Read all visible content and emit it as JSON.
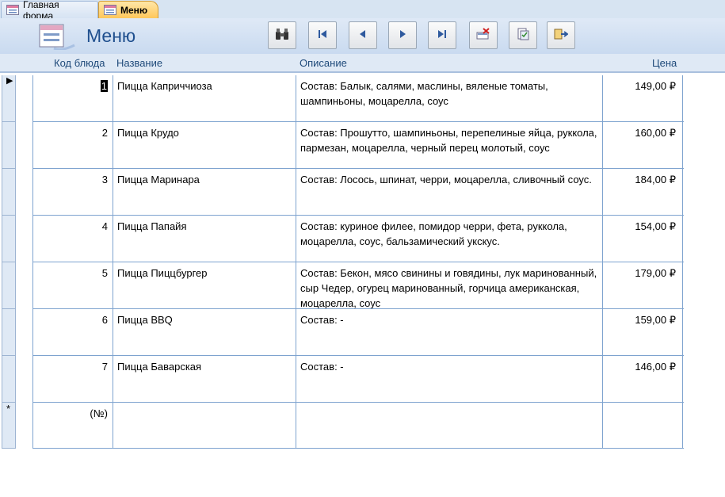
{
  "tabs": [
    {
      "label": "Главная форма",
      "active": false
    },
    {
      "label": "Меню",
      "active": true
    }
  ],
  "header": {
    "title": "Меню",
    "nav_buttons": [
      {
        "icon": "binoculars-icon",
        "action": "find"
      },
      {
        "icon": "first-record-icon",
        "action": "first"
      },
      {
        "icon": "previous-record-icon",
        "action": "previous"
      },
      {
        "icon": "next-record-icon",
        "action": "next"
      },
      {
        "icon": "last-record-icon",
        "action": "last"
      },
      {
        "icon": "delete-record-icon",
        "action": "delete"
      },
      {
        "icon": "save-record-icon",
        "action": "save"
      },
      {
        "icon": "close-form-icon",
        "action": "close"
      }
    ]
  },
  "columns": {
    "id": "Код блюда",
    "name": "Название",
    "description": "Описание",
    "price": "Цена"
  },
  "rows": [
    {
      "id": "1",
      "name": "Пицца Каприччиоза",
      "description": "Состав: Балык, салями, маслины, вяленые томаты, шампиньоны, моцарелла, соус",
      "price": "149,00 ₽"
    },
    {
      "id": "2",
      "name": "Пицца Крудо",
      "description": "Состав:  Прошутто, шампиньоны, перепелиные яйца, руккола, пармезан, моцарелла, черный перец молотый, соус",
      "price": "160,00 ₽"
    },
    {
      "id": "3",
      "name": "Пицца Маринара",
      "description": "Состав: Лосось, шпинат, черри, моцарелла, сливочный соус.",
      "price": "184,00 ₽"
    },
    {
      "id": "4",
      "name": "Пицца Папайя",
      "description": "Состав: куриное филее, помидор черри, фета, руккола, моцарелла, соус, бальзамический укскус.",
      "price": "154,00 ₽"
    },
    {
      "id": "5",
      "name": "Пицца Пиццбургер",
      "description": "Состав: Бекон, мясо свинины и говядины, лук маринованный, сыр Чедер, огурец маринованный, горчица американская, моцарелла, соус",
      "price": "179,00 ₽"
    },
    {
      "id": "6",
      "name": "Пицца BBQ",
      "description": "Состав: -",
      "price": "159,00 ₽"
    },
    {
      "id": "7",
      "name": "Пицца Баварская",
      "description": "Состав: -",
      "price": "146,00 ₽"
    }
  ],
  "new_row": {
    "id": "(№)",
    "name": "",
    "description": "",
    "price": ""
  },
  "selector": {
    "current_marker": "▶",
    "new_marker": "*"
  },
  "colors": {
    "header_bg": "#c9daf0",
    "title": "#1f4f8e",
    "active_tab": "#ffc75a",
    "grid_line": "#7ea3cf"
  }
}
